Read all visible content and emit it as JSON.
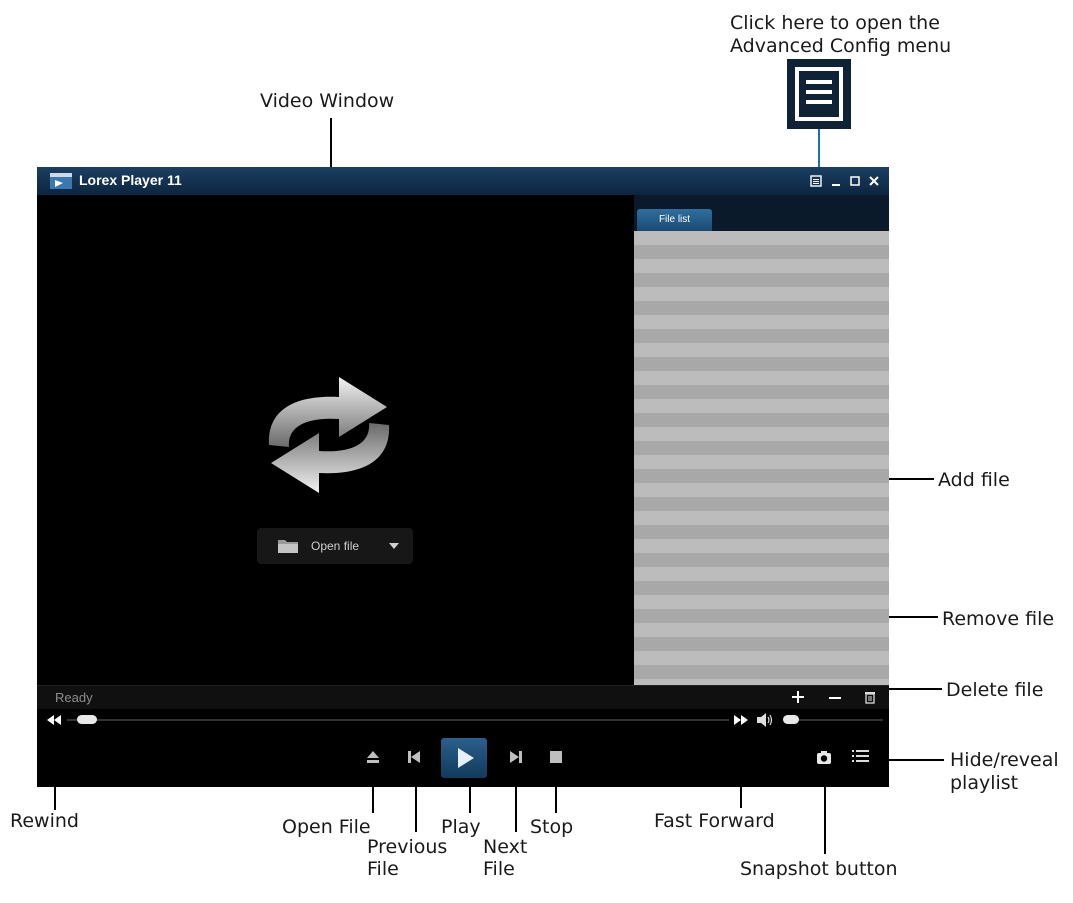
{
  "app": {
    "title": "Lorex Player 11"
  },
  "playlist": {
    "tab_label": "File list"
  },
  "video": {
    "open_file_label": "Open file"
  },
  "status": {
    "text": "Ready"
  },
  "callouts": {
    "advanced_config": "Click here to open the",
    "advanced_config_2": "Advanced Config menu",
    "video_window": "Video Window",
    "add_file": "Add file",
    "remove_file": "Remove file",
    "delete_file": "Delete file",
    "hide_reveal": "Hide/reveal",
    "hide_reveal_2": "playlist",
    "rewind": "Rewind",
    "open_file": "Open File",
    "previous_file": "Previous",
    "previous_file_2": "File",
    "play": "Play",
    "next_file": "Next",
    "next_file_2": "File",
    "stop": "Stop",
    "fast_forward": "Fast Forward",
    "snapshot": "Snapshot button"
  },
  "colors": {
    "titlebar": "#0c2540",
    "accent": "#1f6fae",
    "playlist_stripe_light": "#bcbcbc",
    "playlist_stripe_dark": "#a8a8a8"
  },
  "icons": [
    "menu-icon",
    "minimize-icon",
    "maximize-icon",
    "close-icon",
    "repeat-arrows-icon",
    "folder-icon",
    "chevron-down-icon",
    "rewind-icon",
    "fast-forward-icon",
    "volume-icon",
    "eject-icon",
    "previous-icon",
    "play-icon",
    "next-icon",
    "stop-icon",
    "camera-icon",
    "playlist-toggle-icon",
    "plus-icon",
    "minus-icon",
    "trash-icon"
  ]
}
